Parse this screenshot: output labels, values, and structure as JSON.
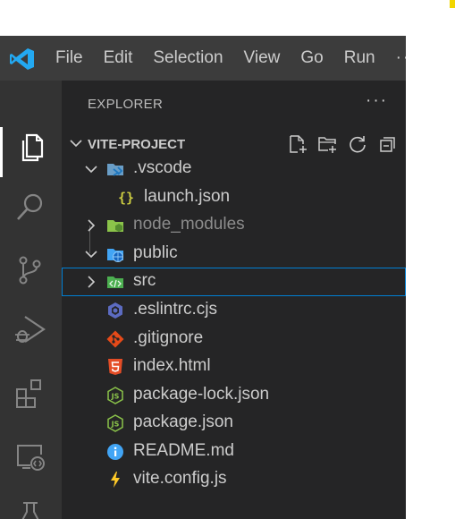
{
  "menu": {
    "file": "File",
    "edit": "Edit",
    "selection": "Selection",
    "view": "View",
    "go": "Go",
    "run": "Run",
    "more": "···"
  },
  "activity_bar": [
    "explorer-icon",
    "search-icon",
    "source-control-icon",
    "run-debug-icon",
    "extensions-icon",
    "remote-explorer-icon",
    "testing-icon"
  ],
  "explorer": {
    "title": "EXPLORER",
    "more": "···",
    "project": "VITE-PROJECT",
    "section_actions": [
      "new-file-icon",
      "new-folder-icon",
      "refresh-icon",
      "collapse-all-icon"
    ],
    "items": [
      {
        "name": ".vscode",
        "type": "folder",
        "expanded": true
      },
      {
        "name": "launch.json",
        "type": "file"
      },
      {
        "name": "node_modules",
        "type": "folder",
        "expanded": false
      },
      {
        "name": "public",
        "type": "folder",
        "expanded": true
      },
      {
        "name": "src",
        "type": "folder",
        "expanded": false,
        "selected": true
      },
      {
        "name": ".eslintrc.cjs",
        "type": "file"
      },
      {
        "name": ".gitignore",
        "type": "file"
      },
      {
        "name": "index.html",
        "type": "file"
      },
      {
        "name": "package-lock.json",
        "type": "file"
      },
      {
        "name": "package.json",
        "type": "file"
      },
      {
        "name": "README.md",
        "type": "file"
      },
      {
        "name": "vite.config.js",
        "type": "file"
      }
    ]
  },
  "colors": {
    "accent": "#007fd4",
    "titlebar": "#3c3c3c",
    "activitybar": "#333333",
    "sidebar": "#252526",
    "text": "#cccccc"
  }
}
